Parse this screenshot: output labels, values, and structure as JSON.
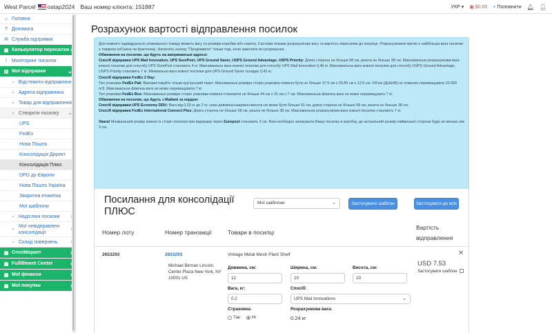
{
  "topbar": {
    "brand": "West Parcel",
    "user": "ostap2024",
    "client_number": "Ваш номер клієнта: 151887",
    "language": "УКР",
    "balance": "$0.00",
    "topup": "Поповнити"
  },
  "sidebar": {
    "items": [
      {
        "label": "Головна",
        "icon": "home-icon"
      },
      {
        "label": "Допомога",
        "icon": "help-icon"
      },
      {
        "label": "Служба підтримки",
        "icon": "support-icon"
      },
      {
        "label": "Калькулятор пересилки",
        "icon": "calculator-icon"
      },
      {
        "label": "Моніторинг посилок",
        "icon": "monitor-icon"
      },
      {
        "label": "Мої відправки",
        "icon": "shipments-icon"
      },
      {
        "label": "Відстежити відправлення",
        "icon": "track-icon"
      },
      {
        "label": "Адреса відправника",
        "icon": "address-icon"
      },
      {
        "label": "Товар для відправлення",
        "icon": "box-icon"
      },
      {
        "label": "Створити посилку",
        "icon": "create-icon"
      },
      {
        "label": "UPS"
      },
      {
        "label": "FedEx"
      },
      {
        "label": "Нова Пошта"
      },
      {
        "label": "Консолідація Директ"
      },
      {
        "label": "Консолідація Плюс"
      },
      {
        "label": "DPD до Європи"
      },
      {
        "label": "Нова Пошта Україна"
      },
      {
        "label": "Зворотна етикетка"
      },
      {
        "label": "Мої шаблони"
      },
      {
        "label": "Надіслані посилки",
        "icon": "sent-icon"
      },
      {
        "label": "Мої невідправлені консолідації",
        "icon": "pending-icon"
      },
      {
        "label": "Склад повернень",
        "icon": "warehouse-icon"
      },
      {
        "label": "OmniМаркет",
        "icon": "market-icon"
      },
      {
        "label": "Fulfillment Center",
        "icon": "fulfillment-icon"
      },
      {
        "label": "Мої фінанси",
        "icon": "finance-icon"
      },
      {
        "label": "Мої покупки",
        "icon": "purchases-icon"
      }
    ]
  },
  "page": {
    "title": "Розрахунок вартості відправлення посилок"
  },
  "info": {
    "intro": "Для кожного індивідуально упакованого товару вкажіть вагу та розміри коробки або пакета. Система покаже розрахункову вагу та вартість пересилки до покупця. Розрахунковою вагою є найбільша вага посилки з товаром (об'ємна чи фактична). Натисніть кнопку \"Продовжити\" тільки тоді, коли закінчите всі розрахунки.",
    "us_heading": "Обмеження на посилки, що йдуть на американські адреси:",
    "ups_heading": "Спосіб відправки UPS Mail Innovation, UPS SurePost, UPS Ground Saver, USPS Ground Advantage, USPS Priority:",
    "ups_text": " Довга сторона не більше 58 см, решта не більше 38 см. Максимальна розрахункова вага кожної посилки для способу UPS SurePost становить 4 кг. Максимальна вага кожної посилки для способу UPS Mail Innovation 0,45 кг. Максимальна вага кожної посилки для способу USPS Ground Advantage, USPS Priority становить 7 кг. Мінімальна вага кожної посилки для UPS Ground Saver складає 0,42 кг.",
    "fedex2_heading": "Спосіб відправки FedEx 2 Day:",
    "fedex_pak_a": "Тип упаковки ",
    "fedex_pak_b": "FedEx Pak",
    "fedex_pak_c": ": Використовуйте тільки кур'єрський пакет. Максимальні розміри сторін упаковки повинні бути не більше 37.5 см х 29.85 см х 12.5 см. Об'єм (ДхШхВ) не повинен перевищувати 10.000 от3. Максимальна фізична вага не може перевищувати 7 кг.",
    "fedex_box_a": "Тип упаковки ",
    "fedex_box_b": "FedEx Box",
    "fedex_box_c": ": Максимальні розміри сторін упаковки повинні становити не більше 44 см х 31 см х 7 см. Максимальна фізична вага не може перевищувати 7 кг.",
    "miami_heading": "Обмеження на посилки, що йдуть з Майамі за кордон:",
    "ddu_heading": "Спосіб відправки UPS Economy DDU:",
    "ddu_text": " Вага від 0,03 кг до 2 кг, сума довжина+ширина+висота не може бути більше 91 см, довга сторона не більше 58 см, решта не більше 38 см.",
    "fic_heading": "Спосіб відправки FedEx International Connect Plus:",
    "fic_text": " Довга сторона не більше 58 см, решта не більше 38 см. Максимальна розрахункова вага кожної посилки становить 7 кг.",
    "note_heading": "Увага!",
    "note_a": " Мінімальний розмір кожної із сторін посилки при відправці через ",
    "note_b": "Surepost",
    "note_c": " становить 3 см. Вам необхідно запакувати Вашу посилку в коробку, де актуальний розмір найменшої сторони буде не менше ніж 3 см."
  },
  "card": {
    "title": "Посилання для консолідації ПЛЮС",
    "template_select": "Мої шаблони",
    "apply_template": "Застосувати шаблон",
    "apply_all": "Застосувати до всіх",
    "headers": {
      "lot": "Номер лоту",
      "transaction": "Номер транзакції",
      "goods": "Товари в посилці",
      "cost": "Вартість відправлення"
    },
    "row": {
      "lot": "2653293",
      "transaction": "2653293",
      "address_1": "Michael Birman Lincoln",
      "address_2": "Center Plaza New York, NY",
      "address_3": "10001 US",
      "product": "Vintage Metal Mesh Plant Shelf",
      "length_label": "Довжина, см:",
      "length_value": "12",
      "width_label": "Ширина, см:",
      "width_value": "10",
      "height_label": "Висота, см:",
      "height_value": "10",
      "weight_label": "Вага, кг:",
      "weight_value": "0.2",
      "method_label": "Спосіб:",
      "method_value": "UPS Mail Innovations",
      "insurance_label": "Страховка:",
      "insurance_yes": "Так",
      "insurance_no": "Ні",
      "calc_weight_label": "Розрахункова вага:",
      "calc_weight_value": "0.24 кг",
      "price": "USD 7.53",
      "apply_template_check": "Застосувати шаблон"
    }
  }
}
